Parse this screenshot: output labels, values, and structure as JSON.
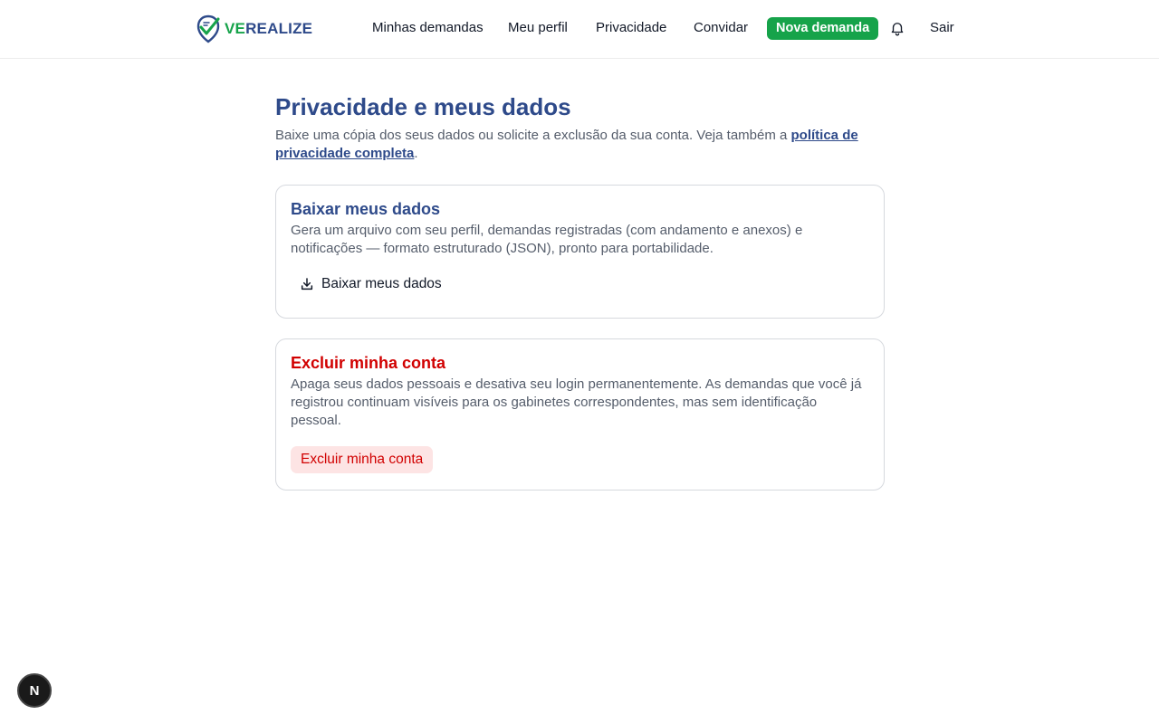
{
  "header": {
    "logo": {
      "text_accent": "VE",
      "text_rest": "REALIZE"
    },
    "nav": {
      "my_requests": "Minhas demandas",
      "my_profile": "Meu perfil",
      "privacy": "Privacidade",
      "invite": "Convidar",
      "new_request": "Nova demanda",
      "logout": "Sair"
    },
    "icons": {
      "notifications": "bell-icon"
    }
  },
  "page": {
    "title": "Privacidade e meus dados",
    "description_before_link": "Baixe uma cópia dos seus dados ou solicite a exclusão da sua conta. Veja também a ",
    "description_link": "política de privacidade completa",
    "description_after_link": "."
  },
  "export_card": {
    "title": "Baixar meus dados",
    "description": "Gera um arquivo com seu perfil, demandas registradas (com andamento e anexos) e notificações — formato estruturado (JSON), pronto para portabilidade.",
    "button_label": "Baixar meus dados",
    "button_icon": "download-icon"
  },
  "delete_card": {
    "title": "Excluir minha conta",
    "description": "Apaga seus dados pessoais e desativa seu login permanentemente. As demandas que você já registrou continuam visíveis para os gabinetes correspondentes, mas sem identificação pessoal.",
    "button_label": "Excluir minha conta"
  },
  "dev_badge": {
    "label": "N"
  },
  "colors": {
    "brand_blue": "#2e4a8a",
    "brand_green": "#16a34a",
    "danger_red": "#d10000",
    "danger_bg": "#fde4e4"
  }
}
